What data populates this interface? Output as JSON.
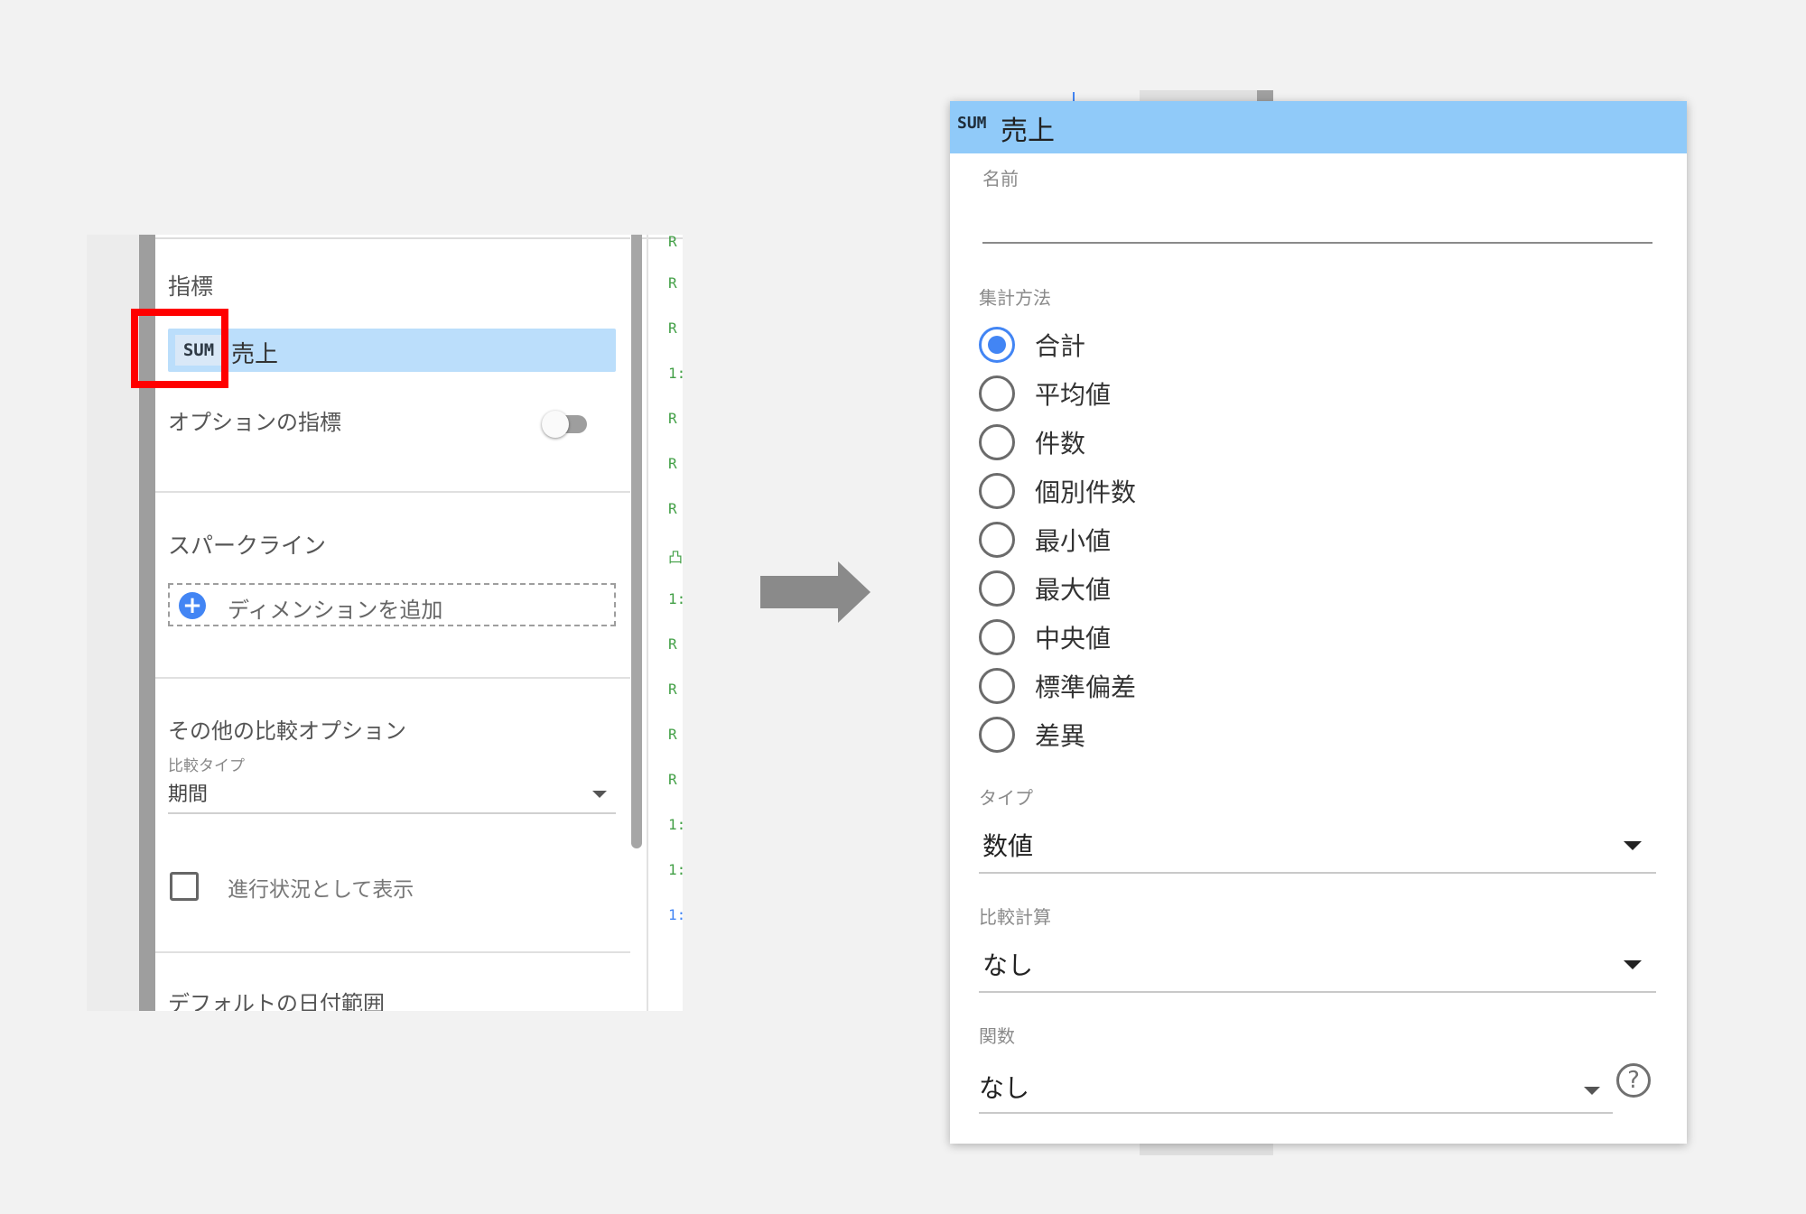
{
  "left_panel": {
    "metrics_title": "指標",
    "metric_chip": {
      "badge": "SUM",
      "name": "売上"
    },
    "optional_metrics_label": "オプションの指標",
    "optional_metrics_enabled": false,
    "sparkline_title": "スパークライン",
    "add_dimension_label": "ディメンションを追加",
    "other_compare_title": "その他の比較オプション",
    "compare_type_label": "比較タイプ",
    "compare_type_value": "期間",
    "progress_checkbox_label": "進行状況として表示",
    "progress_checkbox_checked": false,
    "default_date_range_title": "デフォルトの日付範囲",
    "green_column_glyphs": [
      "R",
      "R",
      "R",
      "1:",
      "R",
      "R",
      "R",
      "凸",
      "1:",
      "R",
      "R",
      "R",
      "R",
      "1:",
      "1:",
      "1:"
    ]
  },
  "metric_dialog": {
    "header_badge": "SUM",
    "header_title": "売上",
    "name_label": "名前",
    "name_value": "",
    "aggregation_label": "集計方法",
    "aggregation_options": [
      "合計",
      "平均値",
      "件数",
      "個別件数",
      "最小値",
      "最大値",
      "中央値",
      "標準偏差",
      "差異"
    ],
    "aggregation_selected": "合計",
    "type_label": "タイプ",
    "type_value": "数値",
    "compare_calc_label": "比較計算",
    "compare_calc_value": "なし",
    "function_label": "関数",
    "function_value": "なし",
    "help_symbol": "?"
  },
  "colors": {
    "highlight_box": "#ff0000",
    "chip_background": "#bbdefb",
    "dialog_header": "#90caf9",
    "radio_selected": "#4285f4",
    "add_button": "#4285f4",
    "arrow": "#8a8a8a"
  }
}
